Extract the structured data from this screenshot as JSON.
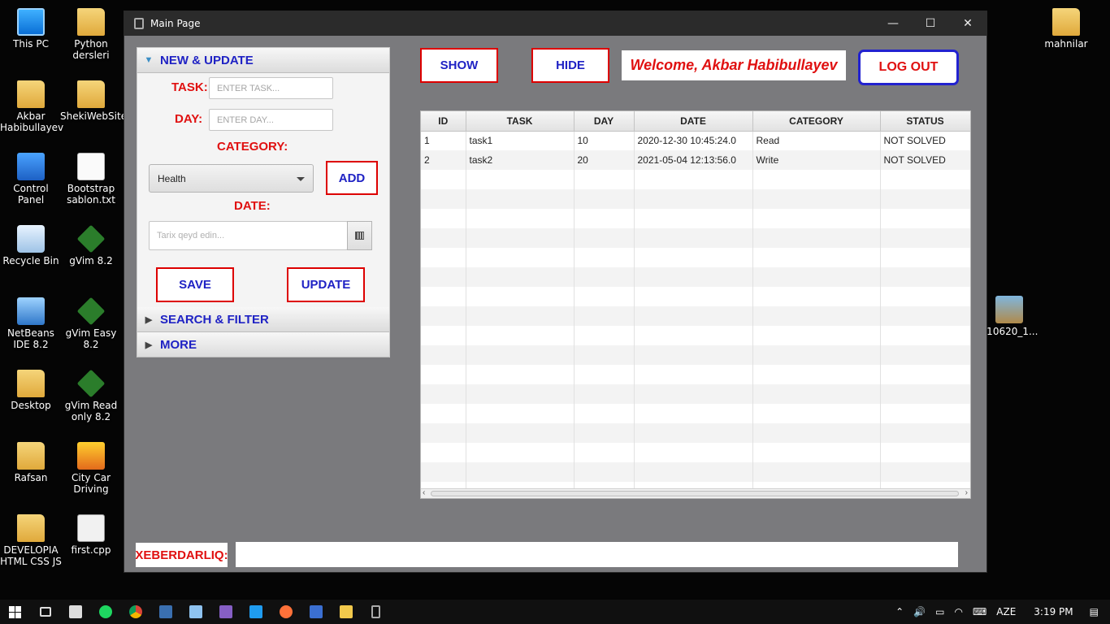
{
  "desktop": {
    "left_col": [
      "This PC",
      "Akbar Habibullayev",
      "Control Panel",
      "Recycle Bin",
      "NetBeans IDE 8.2",
      "Desktop",
      "Rafsan",
      "DEVELOPIA HTML CSS JS"
    ],
    "second_col": [
      "Python dersleri",
      "ShekiWebSite",
      "Bootstrap sablon.txt",
      "gVim 8.2",
      "gVim Easy 8.2",
      "gVim Read only 8.2",
      "City Car Driving",
      "first.cpp"
    ],
    "right_icons": [
      "mahnilar",
      "210620_1..."
    ]
  },
  "window": {
    "title": "Main Page",
    "controls": {
      "minimize": "—",
      "maximize": "☐",
      "close": "✕"
    }
  },
  "accordion": {
    "new_update": {
      "title": "NEW & UPDATE",
      "expanded": true
    },
    "search_filter": {
      "title": "SEARCH & FILTER",
      "expanded": false
    },
    "more": {
      "title": "MORE",
      "expanded": false
    }
  },
  "form": {
    "task_label": "TASK:",
    "task_placeholder": "ENTER TASK...",
    "day_label": "DAY:",
    "day_placeholder": "ENTER DAY...",
    "category_label": "CATEGORY:",
    "category_value": "Health",
    "add_button": "ADD",
    "date_label": "DATE:",
    "date_placeholder": "Tarix qeyd edin...",
    "save_button": "SAVE",
    "update_button": "UPDATE"
  },
  "toolbar": {
    "show_button": "SHOW",
    "hide_button": "HIDE",
    "welcome_text": "Welcome, Akbar Habibullayev",
    "logout_button": "LOG OUT"
  },
  "table": {
    "columns": [
      "ID",
      "TASK",
      "DAY",
      "DATE",
      "CATEGORY",
      "STATUS"
    ],
    "rows": [
      [
        "1",
        "task1",
        "10",
        "2020-12-30 10:45:24.0",
        "Read",
        "NOT SOLVED"
      ],
      [
        "2",
        "task2",
        "20",
        "2021-05-04 12:13:56.0",
        "Write",
        "NOT SOLVED"
      ]
    ]
  },
  "warning": {
    "label": "XEBERDARLIQ:",
    "value": ""
  },
  "taskbar": {
    "language": "AZE",
    "time": "3:19 PM"
  },
  "colors": {
    "accent_red": "#e01010",
    "accent_blue": "#1f22c4",
    "window_bg": "#7a7a7d"
  }
}
